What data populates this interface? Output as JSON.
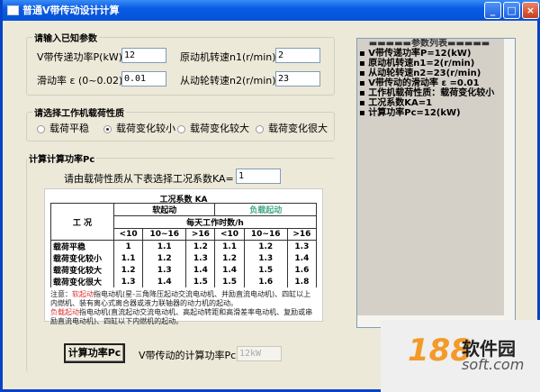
{
  "window": {
    "title": "普通V带传动设计计算",
    "min": "_",
    "max": "□",
    "close": "×"
  },
  "inputs": {
    "legend": "请输入已知参数",
    "power_label": "V带传递功率P(kW)",
    "power_value": "12",
    "n1_label": "原动机转速n1(r/min)",
    "n1_value": "2",
    "slip_label": "滑动率 ε (0~0.02)",
    "slip_value": "0.01",
    "n2_label": "从动轮转速n2(r/min)",
    "n2_value": "23"
  },
  "load": {
    "legend": "请选择工作机载荷性质",
    "options": [
      "载荷平稳",
      "载荷变化较小",
      "载荷变化较大",
      "载荷变化很大"
    ],
    "selected": 1
  },
  "calc": {
    "legend": "计算计算功率Pc",
    "ka_prompt": "请由载荷性质从下表选择工况系数KA=",
    "ka_value": "1",
    "button": "计算功率Pc",
    "result_label": "V带传动的计算功率Pc=",
    "result_value": "12kW"
  },
  "ka_table": {
    "caption": "工况系数 KA",
    "row_header": "工 况",
    "soft": "软起动",
    "heavy": "负载起动",
    "hours": "每天工作时数/h",
    "cols": [
      "<10",
      "10~16",
      ">16",
      "<10",
      "10~16",
      ">16"
    ],
    "rows": [
      {
        "name": "载荷平稳",
        "v": [
          "1",
          "1.1",
          "1.2",
          "1.1",
          "1.2",
          "1.3"
        ]
      },
      {
        "name": "载荷变化较小",
        "v": [
          "1.1",
          "1.2",
          "1.3",
          "1.2",
          "1.3",
          "1.4"
        ]
      },
      {
        "name": "载荷变化较大",
        "v": [
          "1.2",
          "1.3",
          "1.4",
          "1.4",
          "1.5",
          "1.6"
        ]
      },
      {
        "name": "载荷变化很大",
        "v": [
          "1.3",
          "1.4",
          "1.5",
          "1.5",
          "1.6",
          "1.8"
        ]
      }
    ],
    "note_prefix": "注意：",
    "note_soft": "软起动",
    "note1": "指电动机(星-三角降压起动交流电动机、并励直流电动机)、四缸以上内燃机、装有离心式离合器或液力联轴器的动力机的起动。",
    "note_heavy": "负载起动",
    "note2": "指电动机(直流起动交流电动机、高起动转距和高滑差率电动机、复励或串励直流电动机)、四缸以下内燃机的起动。"
  },
  "params_list": {
    "header": "▬▬▬▬▬参数列表▬▬▬▬▬",
    "items": [
      "▪ V带传递功率P=12(kW)",
      "▪ 原动机转速n1=2(r/min)",
      "▪ 从动轮转速n2=23(r/min)",
      "▪ V带传动的滑动率 ε =0.01",
      "▪ 工作机载荷性质：载荷变化较小",
      "▪ 工况系数KA=1",
      "▪ 计算功率Pc=12(kW)"
    ]
  },
  "watermark": {
    "number": "188",
    "cn": "软件园",
    "en": "soft.com"
  }
}
